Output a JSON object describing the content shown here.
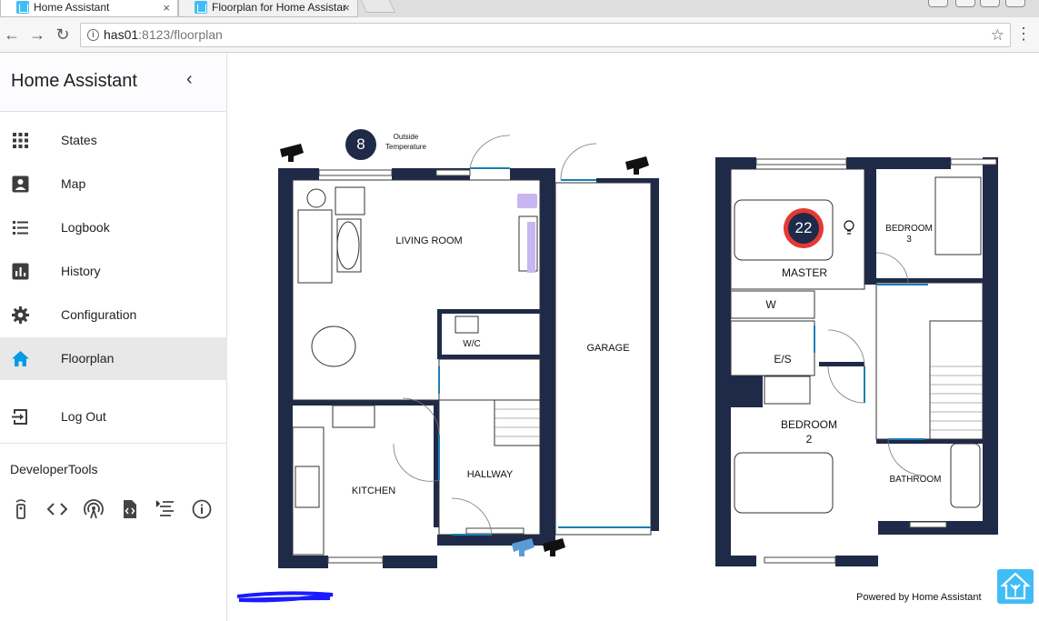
{
  "browser": {
    "tabs": [
      {
        "label": "Home Assistant",
        "close": "×"
      },
      {
        "label": "Floorplan for Home Assistar",
        "close": "×"
      }
    ],
    "url_host": "has01",
    "url_path": ":8123/floorplan",
    "back_icon": "←",
    "forward_icon": "→",
    "reload_icon": "↻",
    "star_icon": "☆",
    "menu_icon": "⋮"
  },
  "sidebar": {
    "title": "Home Assistant",
    "collapse_icon": "‹",
    "items": [
      {
        "label": "States",
        "icon": "apps-icon"
      },
      {
        "label": "Map",
        "icon": "account-box-icon"
      },
      {
        "label": "Logbook",
        "icon": "list-icon"
      },
      {
        "label": "History",
        "icon": "chart-icon"
      },
      {
        "label": "Configuration",
        "icon": "gear-icon"
      },
      {
        "label": "Floorplan",
        "icon": "home-icon",
        "active": true
      },
      {
        "label": "Log Out",
        "icon": "exit-icon"
      }
    ],
    "developer_title": "DeveloperTools",
    "developer_tools": [
      "remote-icon",
      "code-icon",
      "radio-tower-icon",
      "file-code-icon",
      "template-icon",
      "info-icon"
    ]
  },
  "floorplan": {
    "rooms_ground": {
      "living": "LIVING ROOM",
      "wc": "W/C",
      "garage": "GARAGE",
      "kitchen": "KITCHEN",
      "hallway": "HALLWAY"
    },
    "rooms_upper": {
      "master": "MASTER",
      "bedroom3": "BEDROOM\n3",
      "w": "W",
      "es": "E/S",
      "bedroom2": "BEDROOM\n2",
      "bathroom": "BATHROOM"
    },
    "outside_temp_value": "8",
    "outside_temp_label_1": "Outside",
    "outside_temp_label_2": "Temperature",
    "thermostat_value": "22",
    "powered_by": "Powered by Home Assistant",
    "colors": {
      "wall": "#1e2a48",
      "door": "#1a7fb5",
      "accent": "#41bdf5",
      "thermostat_ring": "#e53935",
      "light_furniture": "#c8b6f0"
    }
  }
}
